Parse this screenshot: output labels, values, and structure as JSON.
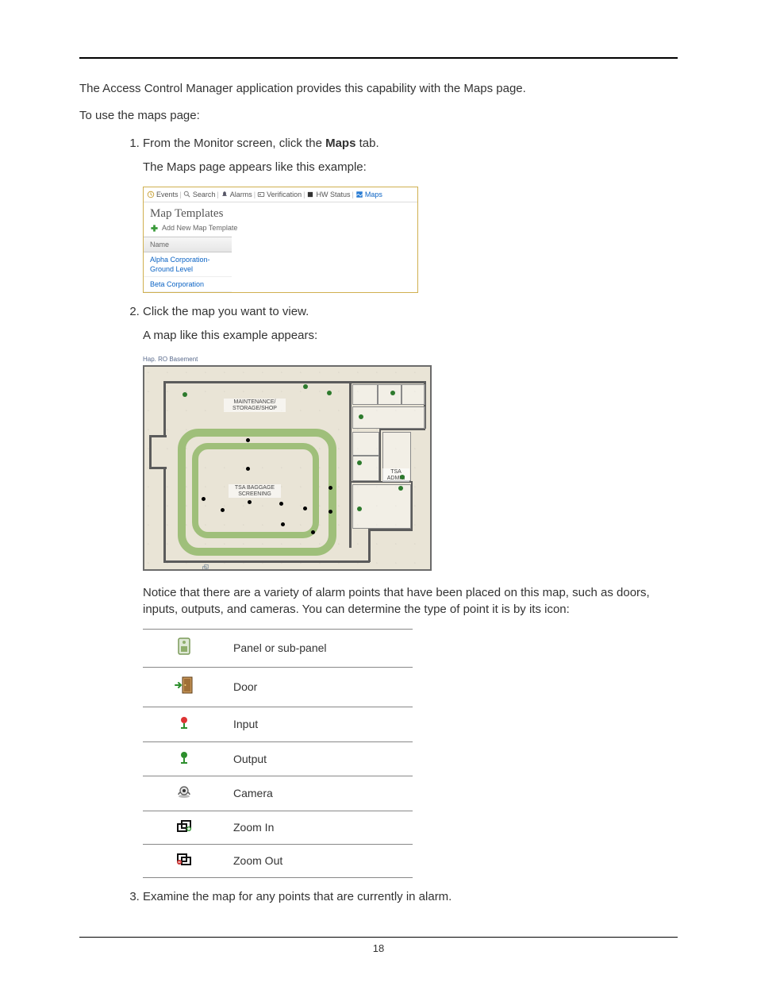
{
  "intro": {
    "p1": "The Access Control Manager application provides this capability with the Maps page.",
    "p2": "To use the maps page:"
  },
  "steps": {
    "s1a": "From the Monitor screen, click the ",
    "s1b": "Maps",
    "s1c": " tab.",
    "s1d": "The Maps page appears like this example:",
    "s2a": "Click the map you want to view.",
    "s2b": "A map like this example appears:",
    "s2c": "Notice that there are a variety of alarm points that have been placed on this map, such as doors, inputs, outputs, and cameras. You can determine the type of point it is by its icon:",
    "s3": "Examine the map for any points that are currently in alarm."
  },
  "shot1": {
    "tabs": {
      "events": "Events",
      "search": "Search",
      "alarms": "Alarms",
      "verification": "Verification",
      "hwstatus": "HW Status",
      "maps": "Maps"
    },
    "title": "Map Templates",
    "add": "Add New Map Template",
    "col": "Name",
    "row1": "Alpha Corporation-Ground Level",
    "row2": "Beta Corporation"
  },
  "shot2": {
    "crumb": "Hap. RO Basement",
    "labels": {
      "maint": "MAINTENANCE/\nSTORAGE/SHOP",
      "screen": "TSA BAGGAGE\nSCREENING",
      "admin": "TSA\nADMIN"
    }
  },
  "iconTable": {
    "panel": "Panel or sub-panel",
    "door": "Door",
    "input": "Input",
    "output": "Output",
    "camera": "Camera",
    "zoomin": "Zoom In",
    "zoomout": "Zoom Out"
  },
  "pageNumber": "18"
}
